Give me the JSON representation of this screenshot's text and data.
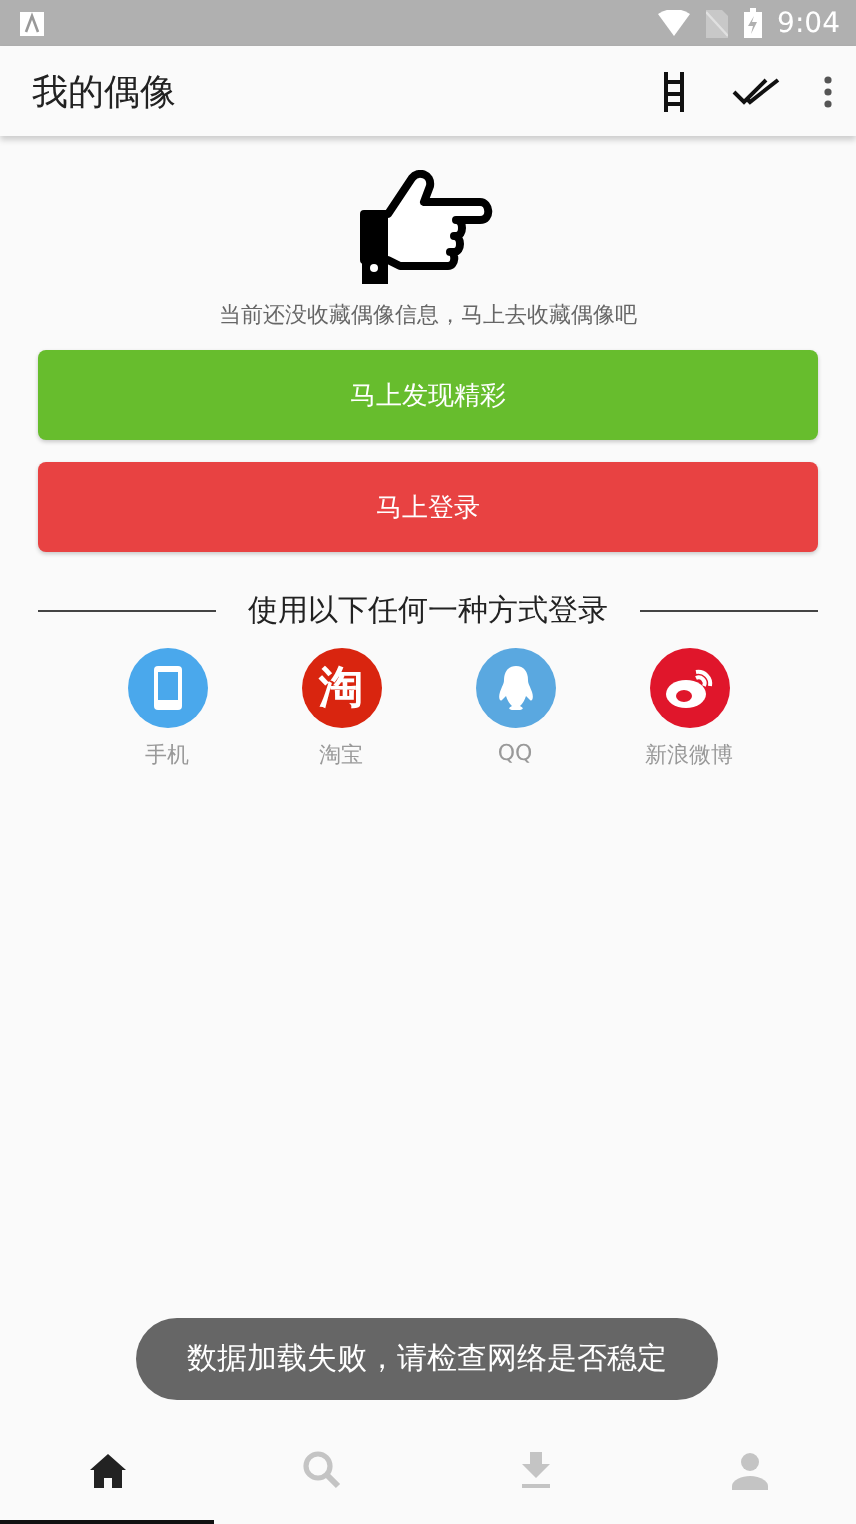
{
  "status_bar": {
    "time": "9:04"
  },
  "app_bar": {
    "title": "我的偶像"
  },
  "empty_state": {
    "message": "当前还没收藏偶像信息，马上去收藏偶像吧"
  },
  "buttons": [
    {
      "label": "马上发现精彩",
      "kind": "primary"
    },
    {
      "label": "马上登录",
      "kind": "danger"
    }
  ],
  "login_divider": {
    "label": "使用以下任何一种方式登录"
  },
  "login_options": [
    {
      "kind": "phone",
      "label": "手机",
      "color": "#4aa8ec"
    },
    {
      "kind": "taobao",
      "label": "淘宝",
      "glyph": "淘",
      "color": "#d9250f"
    },
    {
      "kind": "qq",
      "label": "QQ",
      "color": "#5aa8e0"
    },
    {
      "kind": "weibo",
      "label": "新浪微博",
      "color": "#e0162b"
    }
  ],
  "toast": {
    "message": "数据加载失败，请检查网络是否稳定"
  },
  "bottom_nav": [
    {
      "kind": "home",
      "selected": true
    },
    {
      "kind": "search",
      "selected": false
    },
    {
      "kind": "download",
      "selected": false
    },
    {
      "kind": "profile",
      "selected": false
    }
  ]
}
